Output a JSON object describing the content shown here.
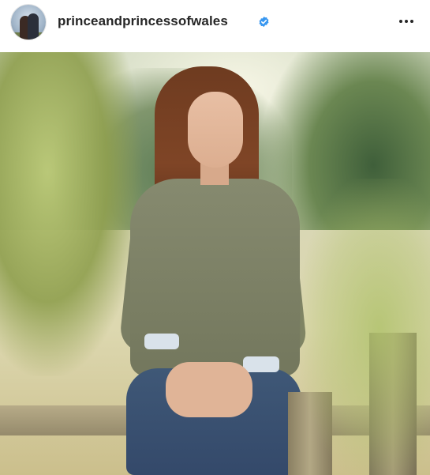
{
  "post": {
    "username": "princeandprincessofwales",
    "verified": true,
    "verified_icon": "verified-badge-icon",
    "more_icon": "more-options-icon",
    "accent_color": "#3897f0"
  },
  "image": {
    "description_icon": "post-photo"
  }
}
